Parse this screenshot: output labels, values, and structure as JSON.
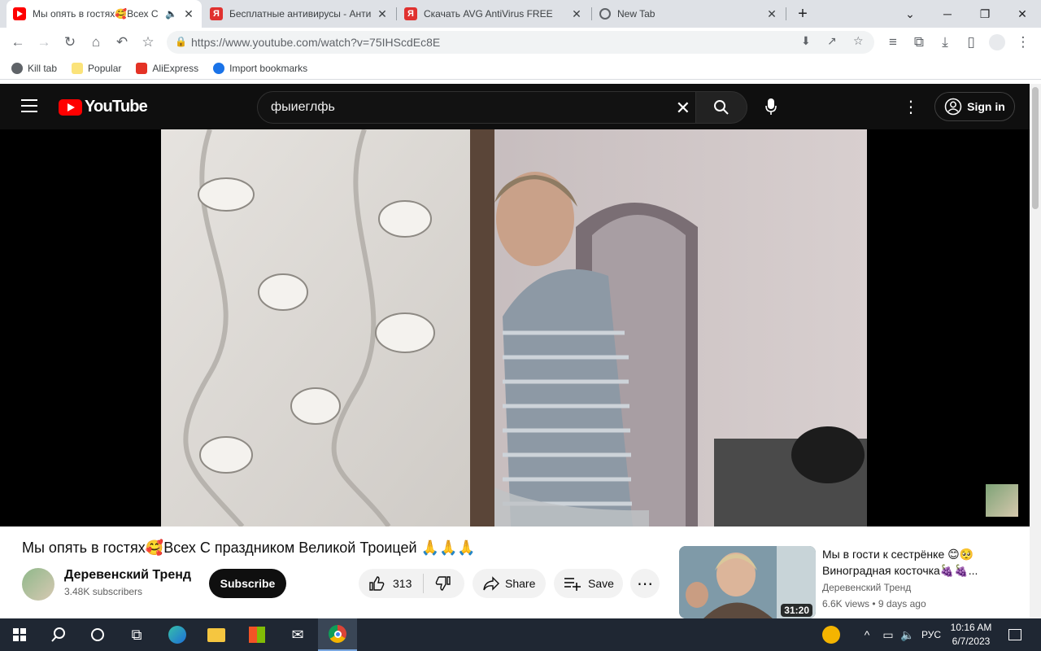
{
  "tabs": [
    {
      "title": "Мы опять в гостях🥰Всех С",
      "active": true
    },
    {
      "title": "Бесплатные антивирусы - Анти"
    },
    {
      "title": "Скачать AVG AntiVirus FREE"
    },
    {
      "title": "New Tab"
    }
  ],
  "toolbar": {
    "url": "https://www.youtube.com/watch?v=75IHScdEc8E"
  },
  "bookmarks": [
    {
      "label": "Kill tab"
    },
    {
      "label": "Popular"
    },
    {
      "label": "AliExpress"
    },
    {
      "label": "Import bookmarks"
    }
  ],
  "youtube": {
    "logo_text": "YouTube",
    "search_query": "фыиеглфь",
    "sign_in_label": "Sign in"
  },
  "video": {
    "title": "Мы опять в гостях🥰Всех С праздником Великой Троицей 🙏🙏🙏",
    "channel_name": "Деревенский Тренд",
    "subscribers": "3.48K subscribers",
    "subscribe_label": "Subscribe",
    "likes": "313",
    "share_label": "Share",
    "save_label": "Save"
  },
  "recommendation": {
    "title": "Мы в гости к сестрёнке 😊🥺 Виноградная косточка🍇🍇...",
    "channel": "Деревенский Тренд",
    "views": "6.6K views",
    "age": "9 days ago",
    "duration": "31:20"
  },
  "taskbar": {
    "language": "РУС",
    "time": "10:16 AM",
    "date": "6/7/2023"
  },
  "colors": {
    "youtube_red": "#ff0000",
    "page_dark": "#0f0f0f",
    "taskbar": "#1f2733"
  }
}
